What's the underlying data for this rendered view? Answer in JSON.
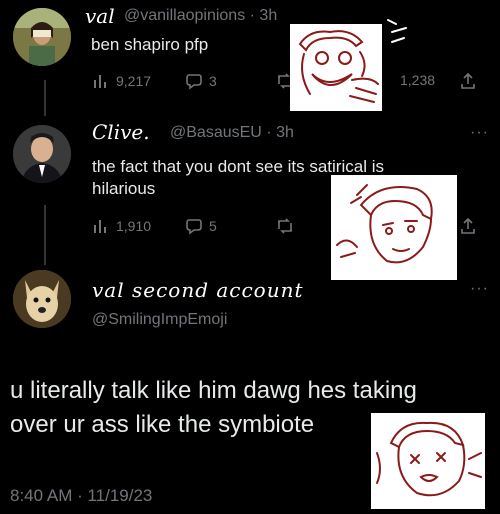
{
  "tweet1": {
    "name": "val",
    "handle": "@vanillaopinions",
    "time": "· 3h",
    "text": "ben shapiro pfp",
    "views": "9,217",
    "replies": "3",
    "likes": "1,238"
  },
  "tweet2": {
    "name": "Clive.",
    "handle": "@BasausEU",
    "time": "· 3h",
    "text_line1": "the fact that you dont see its satirical is",
    "text_line2": "hilarious",
    "views": "1,910",
    "replies": "5"
  },
  "tweet3": {
    "name": "val second account",
    "handle": "@SmilingImpEmoji",
    "text_line1": "u literally talk like him dawg hes taking",
    "text_line2": "over ur ass like the symbiote",
    "timestamp": "8:40 AM · 11/19/23"
  },
  "more_label": "···",
  "colors": {
    "background": "#000000",
    "muted": "#71767b",
    "text": "#e7e9ea",
    "doodle_ink": "#8b1a1a"
  }
}
